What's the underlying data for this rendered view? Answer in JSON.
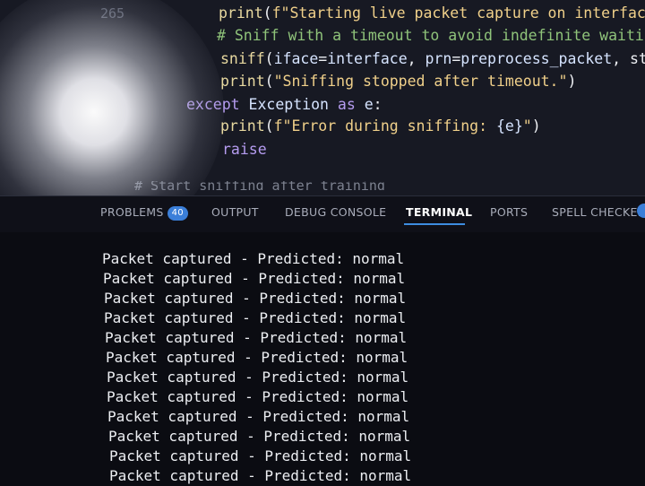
{
  "editor": {
    "line_number": "265",
    "lines": [
      {
        "parts": [
          {
            "t": "print",
            "c": "fn"
          },
          {
            "t": "(",
            "c": "plain"
          },
          {
            "t": "f\"Starting live packet capture on interface",
            "c": "str"
          }
        ]
      },
      {
        "parts": [
          {
            "t": "# Sniff with a timeout to avoid indefinite waitin",
            "c": "cm"
          }
        ]
      },
      {
        "parts": [
          {
            "t": "sniff",
            "c": "fn"
          },
          {
            "t": "(",
            "c": "plain"
          },
          {
            "t": "iface",
            "c": "var"
          },
          {
            "t": "=",
            "c": "plain"
          },
          {
            "t": "interface",
            "c": "var"
          },
          {
            "t": ", ",
            "c": "plain"
          },
          {
            "t": "prn",
            "c": "var"
          },
          {
            "t": "=",
            "c": "plain"
          },
          {
            "t": "preprocess_packet",
            "c": "var"
          },
          {
            "t": ", sto",
            "c": "plain"
          }
        ]
      },
      {
        "parts": [
          {
            "t": "print",
            "c": "fn"
          },
          {
            "t": "(",
            "c": "plain"
          },
          {
            "t": "\"Sniffing stopped after timeout.\"",
            "c": "str"
          },
          {
            "t": ")",
            "c": "plain"
          }
        ]
      },
      {
        "parts": [
          {
            "t": "except ",
            "c": "kw"
          },
          {
            "t": "Exception ",
            "c": "var"
          },
          {
            "t": "as ",
            "c": "kw"
          },
          {
            "t": "e",
            "c": "var"
          },
          {
            "t": ":",
            "c": "plain"
          }
        ]
      },
      {
        "parts": [
          {
            "t": "print",
            "c": "fn"
          },
          {
            "t": "(",
            "c": "plain"
          },
          {
            "t": "f\"Error during sniffing: ",
            "c": "str"
          },
          {
            "t": "{e}",
            "c": "var"
          },
          {
            "t": "\"",
            "c": "str"
          },
          {
            "t": ")",
            "c": "plain"
          }
        ]
      },
      {
        "parts": [
          {
            "t": "raise",
            "c": "kw"
          }
        ]
      }
    ],
    "cut_text": "# Start sniffing after training"
  },
  "panel": {
    "tabs": [
      {
        "label": "PROBLEMS",
        "badge": "40",
        "name": "tab-problems"
      },
      {
        "label": "OUTPUT",
        "name": "tab-output"
      },
      {
        "label": "DEBUG CONSOLE",
        "name": "tab-debug-console"
      },
      {
        "label": "TERMINAL",
        "name": "tab-terminal",
        "active": true
      },
      {
        "label": "PORTS",
        "name": "tab-ports"
      },
      {
        "label": "SPELL CHECKER",
        "name": "tab-spell-checker"
      }
    ]
  },
  "terminal": {
    "lines": [
      "Packet captured - Predicted: normal",
      "Packet captured - Predicted: normal",
      "Packet captured - Predicted: normal",
      "Packet captured - Predicted: normal",
      "Packet captured - Predicted: normal",
      "Packet captured - Predicted: normal",
      "Packet captured - Predicted: normal",
      "Packet captured - Predicted: normal",
      "Packet captured - Predicted: normal",
      "Packet captured - Predicted: normal",
      "Packet captured - Predicted: normal",
      "Packet captured - Predicted: normal"
    ]
  },
  "colors": {
    "accent": "#3d8de0",
    "badge": "#3b7fd9",
    "editor_bg": "#171923",
    "terminal_bg": "#0b0c12"
  }
}
